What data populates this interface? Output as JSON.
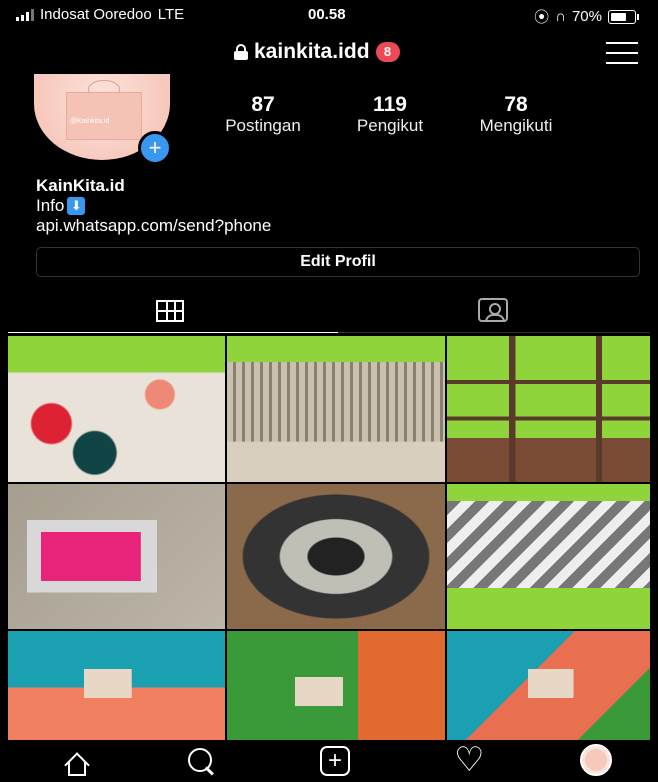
{
  "status_bar": {
    "carrier": "Indosat Ooredoo",
    "network": "LTE",
    "time": "00.58",
    "battery": "70%"
  },
  "header": {
    "username": "kainkita.idd",
    "notifications": "8"
  },
  "profile": {
    "avatar_text": "@Kainkita.id",
    "stats": [
      {
        "value": "87",
        "label": "Postingan"
      },
      {
        "value": "119",
        "label": "Pengikut"
      },
      {
        "value": "78",
        "label": "Mengikuti"
      }
    ],
    "name": "KainKita.id",
    "info": "Info",
    "link": "api.whatsapp.com/send?phone",
    "edit_button": "Edit Profil"
  },
  "tabs": [
    {
      "icon": "grid-icon",
      "active": true
    },
    {
      "icon": "tagged-icon",
      "active": false
    }
  ],
  "posts": [
    {
      "id": 1,
      "subject": "fabric-stack-floral"
    },
    {
      "id": 2,
      "subject": "fabric-stack-patterned"
    },
    {
      "id": 3,
      "subject": "shop-shelves"
    },
    {
      "id": 4,
      "subject": "pink-mask"
    },
    {
      "id": 5,
      "subject": "oval-rug"
    },
    {
      "id": 6,
      "subject": "chevron-pillow"
    },
    {
      "id": 7,
      "subject": "colored-pouches"
    },
    {
      "id": 8,
      "subject": "green-orange-pouches"
    },
    {
      "id": 9,
      "subject": "assorted-pouches"
    }
  ],
  "bottom_nav": [
    "home-icon",
    "search-icon",
    "add-icon",
    "heart-icon",
    "profile-icon"
  ],
  "colors": {
    "background": "#000000",
    "notification_badge": "#ed4956",
    "accent_blue": "#3897f0"
  }
}
